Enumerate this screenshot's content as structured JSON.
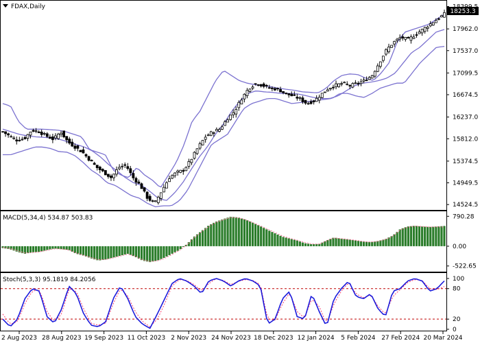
{
  "chart_data": [
    {
      "type": "candlestick",
      "title": "FDAX,Daily",
      "y_ticks": [
        "18399.5",
        "17962.0",
        "17537.0",
        "17099.5",
        "16674.5",
        "16237.0",
        "15812.0",
        "15374.5",
        "14949.5",
        "14524.5"
      ],
      "ylim": [
        14500,
        18420
      ],
      "current_price": "18253.3",
      "bollinger_band_color": "#7b72d0",
      "candle_color": "#000000",
      "series": [
        {
          "name": "price_anchors",
          "values": [
            15950,
            15860,
            15780,
            15820,
            15980,
            15950,
            15870,
            15800,
            15950,
            15750,
            15650,
            15550,
            15400,
            15250,
            15150,
            15050,
            15250,
            15300,
            15050,
            14900,
            14650,
            14550,
            14800,
            15050,
            15150,
            15200,
            15400,
            15650,
            15850,
            15950,
            16000,
            16200,
            16350,
            16600,
            16800,
            16900,
            16850,
            16800,
            16780,
            16700,
            16650,
            16600,
            16500,
            16550,
            16680,
            16800,
            16860,
            16900,
            16850,
            16900,
            16950,
            17050,
            17300,
            17550,
            17700,
            17800,
            17750,
            17850,
            17950,
            18050,
            18150,
            18253
          ]
        },
        {
          "name": "bb_upper_anchors",
          "values": [
            16500,
            16450,
            16150,
            16000,
            16000,
            16000,
            15990,
            15980,
            15950,
            15900,
            15850,
            15600,
            15550,
            15500,
            15200,
            15100,
            15050,
            15250,
            15100,
            15000,
            14850,
            15100,
            15350,
            15700,
            16150,
            16350,
            16650,
            16950,
            17150,
            17050,
            16950,
            16900,
            16870,
            16850,
            16830,
            16800,
            16780,
            16760,
            16730,
            16720,
            16710,
            16800,
            16950,
            17050,
            17080,
            17070,
            17000,
            16950,
            17100,
            17300,
            17700,
            17900,
            17950,
            18000,
            18050,
            18150,
            18250
          ]
        },
        {
          "name": "bb_mid_anchors",
          "values": [
            16000,
            15950,
            15900,
            15870,
            15850,
            15840,
            15830,
            15800,
            15750,
            15700,
            15650,
            15570,
            15450,
            15300,
            15180,
            15050,
            14950,
            14900,
            14780,
            14650,
            14600,
            14750,
            14950,
            15200,
            15450,
            15650,
            15900,
            16100,
            16350,
            16550,
            16700,
            16750,
            16730,
            16720,
            16700,
            16700,
            16690,
            16660,
            16620,
            16600,
            16600,
            16650,
            16750,
            16850,
            16900,
            16920,
            16950,
            17000,
            17100,
            17300,
            17500,
            17600,
            17750,
            17900,
            17950
          ]
        },
        {
          "name": "bb_lower_anchors",
          "values": [
            15500,
            15500,
            15550,
            15600,
            15650,
            15650,
            15620,
            15560,
            15550,
            15480,
            15350,
            15200,
            15100,
            14950,
            14900,
            14800,
            14700,
            14650,
            14550,
            14480,
            14500,
            14500,
            14600,
            14800,
            15100,
            15400,
            15700,
            15800,
            15900,
            16150,
            16400,
            16500,
            16550,
            16600,
            16600,
            16550,
            16500,
            16520,
            16540,
            16560,
            16580,
            16600,
            16700,
            16700,
            16650,
            16620,
            16700,
            16800,
            16850,
            16900,
            16900,
            17100,
            17300,
            17450,
            17600,
            17620
          ]
        }
      ]
    },
    {
      "type": "bar",
      "title": "MACD(5,34,4) 534.87 503.83",
      "y_ticks": [
        "790.28",
        "0.00",
        "-522.65"
      ],
      "ylim": [
        -600,
        850
      ],
      "histogram_color": "#2b7d2b",
      "signal_color": "#ff6f9a",
      "series": [
        {
          "name": "macd_anchors",
          "values": [
            -50,
            -80,
            -150,
            -200,
            -160,
            -150,
            -100,
            -60,
            -80,
            -100,
            -200,
            -250,
            -320,
            -380,
            -350,
            -300,
            -250,
            -200,
            -280,
            -380,
            -420,
            -380,
            -300,
            -200,
            -100,
            50,
            250,
            400,
            550,
            650,
            720,
            780,
            760,
            700,
            620,
            530,
            430,
            340,
            250,
            200,
            150,
            80,
            50,
            60,
            150,
            230,
            200,
            180,
            150,
            120,
            110,
            140,
            190,
            280,
            450,
            520,
            540,
            520,
            510,
            520,
            534.87
          ]
        },
        {
          "name": "signal_anchors",
          "values": [
            -30,
            -60,
            -120,
            -180,
            -170,
            -150,
            -110,
            -70,
            -70,
            -100,
            -180,
            -240,
            -300,
            -360,
            -350,
            -310,
            -260,
            -210,
            -260,
            -360,
            -400,
            -390,
            -320,
            -220,
            -110,
            30,
            220,
            380,
            520,
            630,
            700,
            760,
            750,
            700,
            620,
            540,
            450,
            360,
            270,
            210,
            160,
            100,
            60,
            55,
            140,
            220,
            200,
            180,
            155,
            125,
            110,
            130,
            180,
            260,
            430,
            500,
            530,
            520,
            505,
            510,
            503.83
          ]
        }
      ]
    },
    {
      "type": "line",
      "title": "Stoch(5,3,3) 95.1819 84.2056",
      "y_ticks": [
        "100",
        "80",
        "20",
        "0"
      ],
      "ylim": [
        0,
        108
      ],
      "levels": [
        80,
        20
      ],
      "x_ticks": [
        "2 Aug 2023",
        "28 Aug 2023",
        "19 Sep 2023",
        "11 Oct 2023",
        "2 Nov 2023",
        "24 Nov 2023",
        "18 Dec 2023",
        "12 Jan 2024",
        "5 Feb 2024",
        "27 Feb 2024",
        "20 Mar 2024"
      ],
      "main_color": "#1a1adb",
      "signal_color": "#ff3c6e",
      "series": [
        {
          "name": "stoch_main_anchors",
          "values": [
            20,
            5,
            20,
            60,
            80,
            75,
            25,
            12,
            40,
            85,
            70,
            30,
            8,
            5,
            15,
            60,
            85,
            60,
            25,
            10,
            2,
            30,
            60,
            90,
            100,
            95,
            85,
            70,
            95,
            100,
            95,
            85,
            95,
            100,
            95,
            85,
            10,
            20,
            60,
            75,
            25,
            20,
            70,
            35,
            5,
            60,
            80,
            95,
            65,
            60,
            70,
            40,
            25,
            75,
            80,
            95,
            100,
            95,
            75,
            80,
            95.18
          ]
        },
        {
          "name": "stoch_signal_anchors",
          "values": [
            30,
            10,
            15,
            50,
            75,
            78,
            35,
            15,
            30,
            80,
            75,
            40,
            12,
            8,
            12,
            50,
            80,
            65,
            35,
            15,
            5,
            20,
            50,
            85,
            98,
            96,
            88,
            75,
            90,
            100,
            96,
            88,
            94,
            98,
            96,
            88,
            20,
            18,
            50,
            72,
            35,
            22,
            60,
            45,
            10,
            50,
            75,
            92,
            70,
            62,
            68,
            45,
            30,
            65,
            78,
            92,
            98,
            96,
            80,
            78,
            84.21
          ]
        }
      ]
    }
  ]
}
